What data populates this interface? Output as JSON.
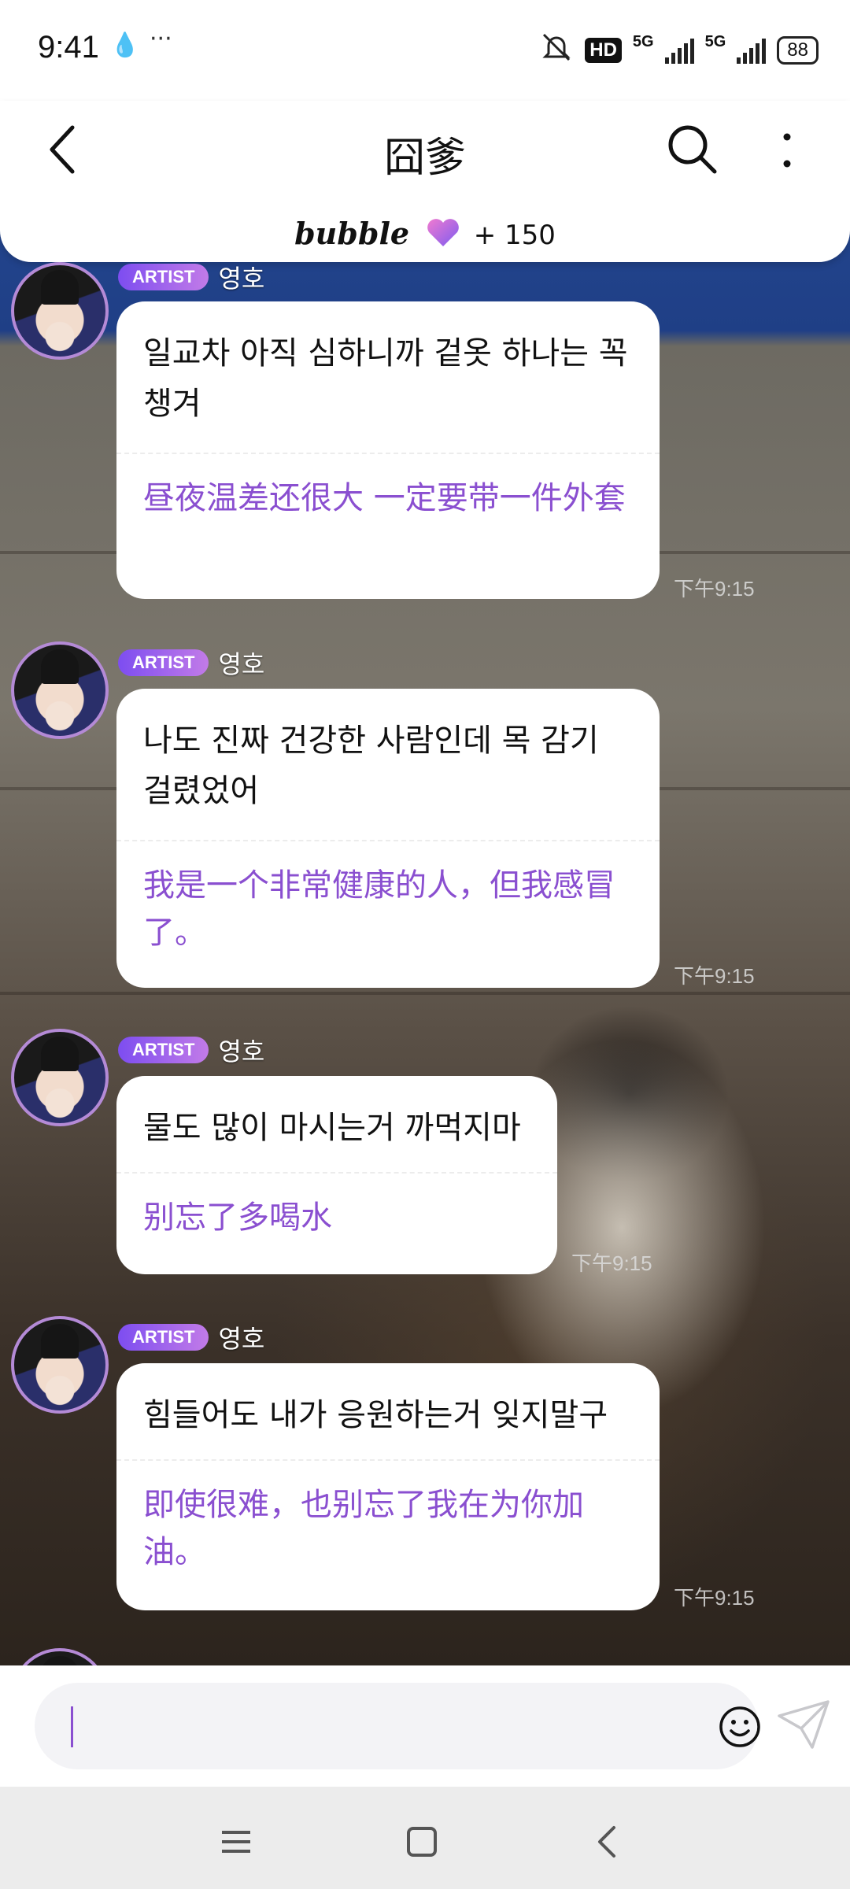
{
  "status_bar": {
    "time": "9:41",
    "more": "···",
    "hd_label": "HD",
    "net1": "5G",
    "net2": "5G",
    "battery": "88"
  },
  "header": {
    "title": "囧爹",
    "brand": "bubble",
    "count": "+ 150"
  },
  "messages": [
    {
      "badge": "ARTIST",
      "name": "영호",
      "ko": "일교차 아직 심하니까 겉옷 하나는 꼭 챙겨",
      "zh": "昼夜温差还很大 一定要带一件外套",
      "time": "下午9:15"
    },
    {
      "badge": "ARTIST",
      "name": "영호",
      "ko": "나도 진짜 건강한 사람인데 목 감기 걸렸었어",
      "zh": "我是一个非常健康的人，但我感冒了。",
      "time": "下午9:15"
    },
    {
      "badge": "ARTIST",
      "name": "영호",
      "ko": "물도 많이 마시는거 까먹지마",
      "zh": "别忘了多喝水",
      "time": "下午9:15"
    },
    {
      "badge": "ARTIST",
      "name": "영호",
      "ko": "힘들어도 내가 응원하는거 잊지말구",
      "zh": "即使很难，也别忘了我在为你加油。",
      "time": "下午9:15"
    }
  ],
  "colors": {
    "accent": "#8a4fd0",
    "badge_start": "#7d4df0",
    "badge_end": "#c27be8"
  },
  "icons": [
    "back-arrow-icon",
    "search-icon",
    "more-vert-icon",
    "heart-icon",
    "emoji-icon",
    "send-icon",
    "menu-icon",
    "home-icon",
    "back-icon"
  ]
}
